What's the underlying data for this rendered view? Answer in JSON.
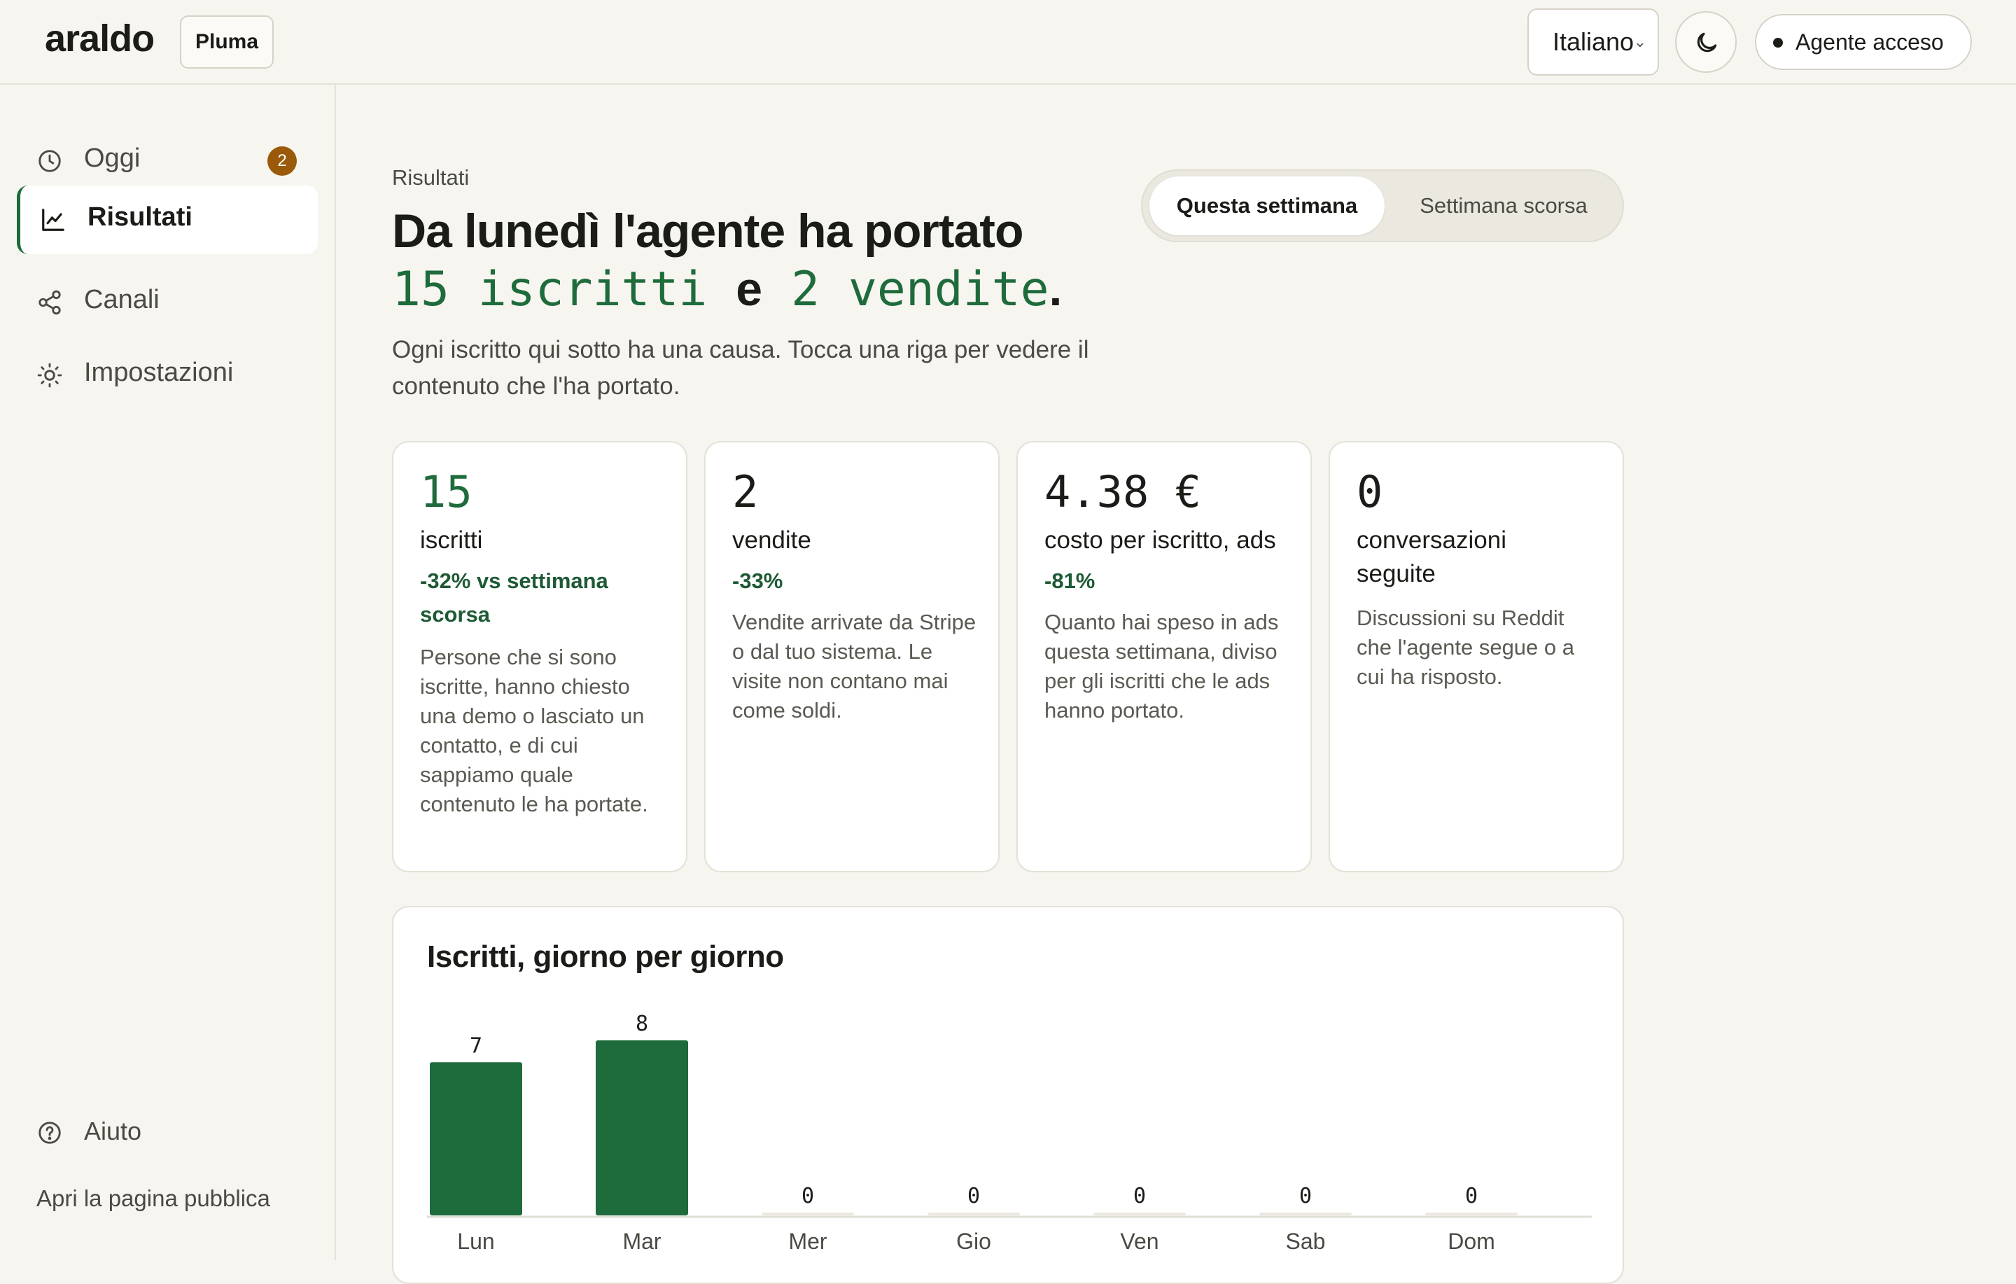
{
  "header": {
    "logo": "araldo",
    "workspace": "Pluma",
    "language": "Italiano",
    "theme_icon": "moon-icon",
    "agent_status": "Agente acceso"
  },
  "sidebar": {
    "items": [
      {
        "label": "Oggi",
        "icon": "clock-icon",
        "badge": "2"
      },
      {
        "label": "Risultati",
        "icon": "chart-line-icon",
        "active": true
      },
      {
        "label": "Canali",
        "icon": "share-icon"
      },
      {
        "label": "Impostazioni",
        "icon": "sun-gear-icon"
      }
    ],
    "help": "Aiuto",
    "public_link": "Apri la pagina pubblica"
  },
  "main": {
    "eyebrow": "Risultati",
    "headline": "Da lunedì l'agente ha portato",
    "metric_a": "15 iscritti",
    "conjunction": "e",
    "metric_b": "2 vendite",
    "period_end": ".",
    "lead": "Ogni iscritto qui sotto ha una causa. Tocca una riga per vedere il contenuto che l'ha portato.",
    "toggle": {
      "active": "Questa settimana",
      "inactive": "Settimana scorsa"
    },
    "cards": [
      {
        "value": "15",
        "caption": "iscritti",
        "delta": "-32% vs settimana scorsa",
        "desc": "Persone che si sono iscritte, hanno chiesto una demo o lasciato un contatto, e di cui sappiamo quale contenuto le ha portate."
      },
      {
        "value": "2",
        "caption": "vendite",
        "delta": "-33%",
        "desc": "Vendite arrivate da Stripe o dal tuo sistema. Le visite non contano mai come soldi."
      },
      {
        "value": "4.38 €",
        "caption": "costo per iscritto, ads",
        "delta": "-81%",
        "desc": "Quanto hai speso in ads questa settimana, diviso per gli iscritti che le ads hanno portato."
      },
      {
        "value": "0",
        "caption": "conversazioni seguite",
        "desc": "Discussioni su Reddit che l'agente segue o a cui ha risposto."
      }
    ]
  },
  "colors": {
    "accent": "#1e6b3c",
    "badge": "#9a5a0a",
    "background": "#f7f5ef"
  },
  "chart_data": {
    "type": "bar",
    "title": "Iscritti, giorno per giorno",
    "categories": [
      "Lun",
      "Mar",
      "Mer",
      "Gio",
      "Ven",
      "Sab",
      "Dom"
    ],
    "values": [
      7,
      8,
      0,
      0,
      0,
      0,
      0
    ],
    "data_labels": [
      "7",
      "8",
      "0",
      "0",
      "0",
      "0",
      "0"
    ],
    "ylim": [
      0,
      8
    ],
    "grid": false,
    "legend": "none"
  }
}
